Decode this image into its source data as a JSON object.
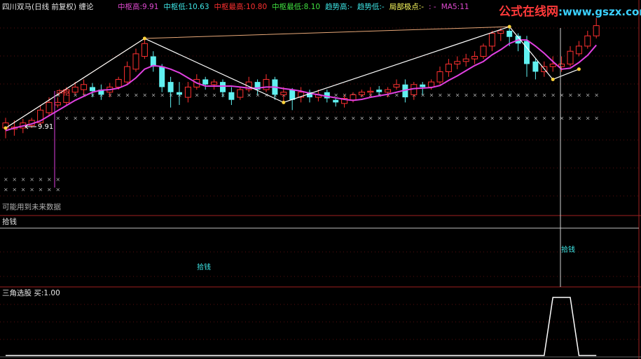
{
  "window": {
    "title": "四川双马(日线 前复权)",
    "indicator": "缠论"
  },
  "header": {
    "items": [
      {
        "label": "中枢高",
        "value": "9.91",
        "color": "#e04ad0"
      },
      {
        "label": "中枢低",
        "value": "10.63",
        "color": "#3ee6e6"
      },
      {
        "label": "中枢最高",
        "value": "10.80",
        "color": "#ff3030"
      },
      {
        "label": "中枢最低",
        "value": "8.10",
        "color": "#40e040"
      },
      {
        "label": "趋势高",
        "value": "-",
        "color": "#3ee6e6"
      },
      {
        "label": "趋势低",
        "value": "-",
        "color": "#3ee6e6"
      },
      {
        "label": "局部极点",
        "value": "-",
        "color": "#ffff60"
      },
      {
        "label": "",
        "value": ": -",
        "color": "#e04ad0"
      },
      {
        "label": "MA5",
        "value": "11",
        "color": "#e04ad0"
      }
    ]
  },
  "watermark": {
    "text_cn": "公式在线网",
    "text_url": ":www.gszx.com.cn"
  },
  "main_panel": {
    "price_marker": "9.91",
    "zhongshu_label": "中枢",
    "future_data_note": "可能用到未来数据"
  },
  "panel2": {
    "title": "拾钱",
    "signals": [
      "拾钱",
      "拾钱"
    ]
  },
  "panel3": {
    "title": "三角选股",
    "buy_label": "买",
    "buy_value": "1.00"
  },
  "chart_data": {
    "type": "candlestick",
    "ylim": [
      7.5,
      11.3
    ],
    "ma5_color": "#e040e0",
    "bi_line_color": "#ffffff",
    "trend_line_color": "#e8a878",
    "up_color": "#ff3030",
    "down_color": "#60f0f0",
    "candles": [
      {
        "o": 9.1,
        "h": 9.3,
        "c": 9.2,
        "l": 8.9
      },
      {
        "o": 9.08,
        "h": 9.25,
        "c": 9.12,
        "l": 8.95
      },
      {
        "o": 9.1,
        "h": 9.28,
        "c": 9.2,
        "l": 9.0
      },
      {
        "o": 9.15,
        "h": 9.3,
        "c": 9.25,
        "l": 9.1
      },
      {
        "o": 9.2,
        "h": 9.55,
        "c": 9.45,
        "l": 9.15
      },
      {
        "o": 9.4,
        "h": 9.7,
        "c": 9.6,
        "l": 9.35
      },
      {
        "o": 9.55,
        "h": 9.7,
        "c": 9.6,
        "l": 9.5
      },
      {
        "o": 9.6,
        "h": 9.9,
        "c": 9.85,
        "l": 9.55
      },
      {
        "o": 9.8,
        "h": 10.0,
        "c": 9.9,
        "l": 9.75
      },
      {
        "o": 9.85,
        "h": 10.05,
        "c": 9.95,
        "l": 9.75
      },
      {
        "o": 9.9,
        "h": 9.98,
        "c": 9.82,
        "l": 9.7
      },
      {
        "o": 9.85,
        "h": 9.95,
        "c": 9.75,
        "l": 9.65
      },
      {
        "o": 9.8,
        "h": 9.98,
        "c": 9.9,
        "l": 9.7
      },
      {
        "o": 9.9,
        "h": 10.1,
        "c": 10.05,
        "l": 9.85
      },
      {
        "o": 10.0,
        "h": 10.4,
        "c": 10.3,
        "l": 9.95
      },
      {
        "o": 10.25,
        "h": 10.65,
        "c": 10.55,
        "l": 10.2
      },
      {
        "o": 10.5,
        "h": 10.85,
        "c": 10.75,
        "l": 10.45
      },
      {
        "o": 10.5,
        "h": 10.6,
        "c": 10.3,
        "l": 10.2
      },
      {
        "o": 10.3,
        "h": 10.35,
        "c": 9.9,
        "l": 9.8
      },
      {
        "o": 10.0,
        "h": 10.1,
        "c": 9.8,
        "l": 9.5
      },
      {
        "o": 9.8,
        "h": 10.0,
        "c": 9.75,
        "l": 9.55
      },
      {
        "o": 9.7,
        "h": 10.0,
        "c": 9.9,
        "l": 9.6
      },
      {
        "o": 9.9,
        "h": 10.15,
        "c": 10.05,
        "l": 9.85
      },
      {
        "o": 10.05,
        "h": 10.1,
        "c": 9.95,
        "l": 9.85
      },
      {
        "o": 9.95,
        "h": 10.05,
        "c": 10.0,
        "l": 9.85
      },
      {
        "o": 10.0,
        "h": 10.05,
        "c": 9.8,
        "l": 9.7
      },
      {
        "o": 9.8,
        "h": 9.9,
        "c": 9.65,
        "l": 9.55
      },
      {
        "o": 9.7,
        "h": 9.9,
        "c": 9.85,
        "l": 9.65
      },
      {
        "o": 9.85,
        "h": 10.1,
        "c": 10.0,
        "l": 9.8
      },
      {
        "o": 10.0,
        "h": 10.05,
        "c": 9.85,
        "l": 9.75
      },
      {
        "o": 9.85,
        "h": 10.15,
        "c": 10.05,
        "l": 9.8
      },
      {
        "o": 10.05,
        "h": 10.1,
        "c": 9.75,
        "l": 9.65
      },
      {
        "o": 9.75,
        "h": 9.9,
        "c": 9.8,
        "l": 9.6
      },
      {
        "o": 9.85,
        "h": 9.88,
        "c": 9.65,
        "l": 9.45
      },
      {
        "o": 9.7,
        "h": 9.9,
        "c": 9.8,
        "l": 9.6
      },
      {
        "o": 9.8,
        "h": 9.85,
        "c": 9.7,
        "l": 9.6
      },
      {
        "o": 9.7,
        "h": 9.85,
        "c": 9.75,
        "l": 9.62
      },
      {
        "o": 9.8,
        "h": 9.85,
        "c": 9.68,
        "l": 9.6
      },
      {
        "o": 9.65,
        "h": 9.7,
        "c": 9.6,
        "l": 9.52
      },
      {
        "o": 9.58,
        "h": 9.75,
        "c": 9.68,
        "l": 9.5
      },
      {
        "o": 9.65,
        "h": 9.8,
        "c": 9.75,
        "l": 9.6
      },
      {
        "o": 9.75,
        "h": 9.85,
        "c": 9.8,
        "l": 9.7
      },
      {
        "o": 9.8,
        "h": 9.9,
        "c": 9.82,
        "l": 9.7
      },
      {
        "o": 9.85,
        "h": 9.92,
        "c": 9.8,
        "l": 9.72
      },
      {
        "o": 9.8,
        "h": 9.9,
        "c": 9.85,
        "l": 9.7
      },
      {
        "o": 9.9,
        "h": 10.05,
        "c": 9.95,
        "l": 9.85
      },
      {
        "o": 9.95,
        "h": 10.05,
        "c": 9.7,
        "l": 9.6
      },
      {
        "o": 9.75,
        "h": 10.0,
        "c": 9.95,
        "l": 9.65
      },
      {
        "o": 9.95,
        "h": 10.0,
        "c": 9.9,
        "l": 9.75
      },
      {
        "o": 9.9,
        "h": 10.05,
        "c": 10.0,
        "l": 9.85
      },
      {
        "o": 10.0,
        "h": 10.3,
        "c": 10.2,
        "l": 9.95
      },
      {
        "o": 10.2,
        "h": 10.45,
        "c": 10.35,
        "l": 10.1
      },
      {
        "o": 10.35,
        "h": 10.5,
        "c": 10.4,
        "l": 10.25
      },
      {
        "o": 10.4,
        "h": 10.55,
        "c": 10.45,
        "l": 10.3
      },
      {
        "o": 10.45,
        "h": 10.6,
        "c": 10.5,
        "l": 10.35
      },
      {
        "o": 10.5,
        "h": 10.75,
        "c": 10.7,
        "l": 10.45
      },
      {
        "o": 10.7,
        "h": 11.0,
        "c": 10.95,
        "l": 10.6
      },
      {
        "o": 10.95,
        "h": 11.05,
        "c": 11.0,
        "l": 10.8
      },
      {
        "o": 11.0,
        "h": 11.08,
        "c": 10.88,
        "l": 10.7
      },
      {
        "o": 10.9,
        "h": 10.95,
        "c": 10.75,
        "l": 10.6
      },
      {
        "o": 10.8,
        "h": 10.9,
        "c": 10.35,
        "l": 10.1
      },
      {
        "o": 10.4,
        "h": 10.45,
        "c": 10.2,
        "l": 10.05
      },
      {
        "o": 10.2,
        "h": 10.4,
        "c": 10.3,
        "l": 10.1
      },
      {
        "o": 10.3,
        "h": 10.5,
        "c": 10.35,
        "l": 10.2
      },
      {
        "o": 10.3,
        "h": 10.5,
        "c": 10.35,
        "l": 10.2
      },
      {
        "o": 10.35,
        "h": 10.7,
        "c": 10.6,
        "l": 10.3
      },
      {
        "o": 10.55,
        "h": 10.8,
        "c": 10.7,
        "l": 10.5
      },
      {
        "o": 10.7,
        "h": 11.0,
        "c": 10.9,
        "l": 10.65
      },
      {
        "o": 10.9,
        "h": 11.25,
        "c": 11.1,
        "l": 10.85
      }
    ],
    "ma5": [
      9.05,
      9.1,
      9.14,
      9.18,
      9.24,
      9.34,
      9.44,
      9.54,
      9.64,
      9.72,
      9.8,
      9.84,
      9.85,
      9.88,
      9.95,
      10.08,
      10.25,
      10.32,
      10.3,
      10.25,
      10.18,
      10.08,
      9.98,
      9.92,
      9.92,
      9.92,
      9.92,
      9.9,
      9.88,
      9.88,
      9.9,
      9.9,
      9.87,
      9.85,
      9.82,
      9.78,
      9.75,
      9.72,
      9.69,
      9.66,
      9.64,
      9.66,
      9.7,
      9.73,
      9.76,
      9.8,
      9.84,
      9.87,
      9.88,
      9.89,
      9.93,
      10.03,
      10.12,
      10.22,
      10.32,
      10.4,
      10.53,
      10.63,
      10.75,
      10.82,
      10.82,
      10.7,
      10.56,
      10.4,
      10.25,
      10.27,
      10.38,
      10.52,
      10.72
    ],
    "bi": [
      [
        0,
        9.1
      ],
      [
        16,
        10.85
      ],
      [
        32,
        9.6
      ],
      [
        58,
        11.08
      ],
      [
        63,
        10.05
      ],
      [
        66,
        10.25
      ]
    ],
    "zhongshu_x_levels": [
      9.75,
      9.3,
      8.1,
      7.9
    ]
  },
  "panel3_data": {
    "type": "line",
    "values": [
      0,
      0,
      0,
      0,
      0,
      0,
      0,
      0,
      0,
      0,
      0,
      0,
      0,
      0,
      0,
      0,
      0,
      0,
      0,
      0,
      0,
      0,
      0,
      0,
      0,
      0,
      0,
      0,
      0,
      0,
      0,
      0,
      0,
      0,
      0,
      0,
      0,
      0,
      0,
      0,
      0,
      0,
      0,
      0,
      0,
      0,
      0,
      0,
      0,
      0,
      0,
      0,
      0,
      0,
      0,
      0,
      0,
      0,
      0,
      0,
      0,
      0,
      0,
      1,
      1,
      1,
      0,
      0,
      0
    ]
  }
}
